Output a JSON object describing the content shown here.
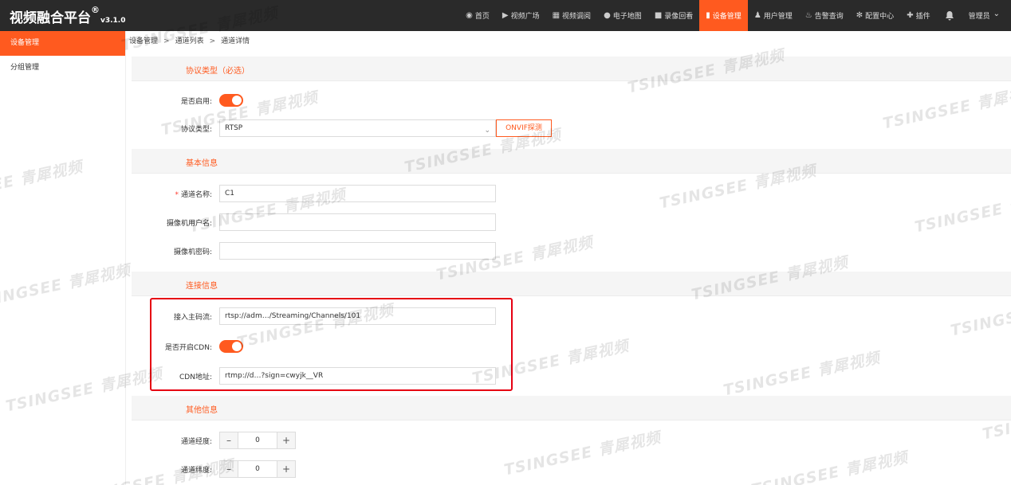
{
  "brand": {
    "title": "视频融合平台",
    "reg": "®",
    "version": "v3.1.0"
  },
  "nav": [
    {
      "label": "首页",
      "icon": "dashboard-icon",
      "glyph": "◉"
    },
    {
      "label": "视频广场",
      "icon": "play-circle-icon",
      "glyph": "▶"
    },
    {
      "label": "视频调阅",
      "icon": "grid-icon",
      "glyph": "▦"
    },
    {
      "label": "电子地图",
      "icon": "map-pin-icon",
      "glyph": "●"
    },
    {
      "label": "录像回看",
      "icon": "video-camera-icon",
      "glyph": "■"
    },
    {
      "label": "设备管理",
      "icon": "device-icon",
      "glyph": "▮"
    },
    {
      "label": "用户管理",
      "icon": "user-icon",
      "glyph": "♟"
    },
    {
      "label": "告警查询",
      "icon": "alarm-icon",
      "glyph": "♨"
    },
    {
      "label": "配置中心",
      "icon": "gear-icon",
      "glyph": "✻"
    },
    {
      "label": "插件",
      "icon": "puzzle-icon",
      "glyph": "✚"
    }
  ],
  "user": {
    "label": "管理员",
    "caret": "⌄",
    "bell": "🔔"
  },
  "sidebar": {
    "items": [
      {
        "label": "设备管理"
      },
      {
        "label": "分组管理"
      }
    ]
  },
  "breadcrumb": {
    "items": [
      "设备管理",
      "通道列表",
      "通道详情"
    ],
    "sep": ">"
  },
  "sections": {
    "protocol": {
      "title": "协议类型（必选）",
      "enable_label": "是否启用:",
      "type_label": "协议类型:",
      "type_value": "RTSP",
      "onvif_button": "ONVIF探测"
    },
    "basic": {
      "title": "基本信息",
      "name_label": "通道名称:",
      "name_value": "C1",
      "username_label": "摄像机用户名:",
      "username_value": "",
      "password_label": "摄像机密码:",
      "password_value": ""
    },
    "connection": {
      "title": "连接信息",
      "stream_label": "接入主码流:",
      "stream_value": "rtsp://adm…/Streaming/Channels/101",
      "cdn_enable_label": "是否开启CDN:",
      "cdn_url_label": "CDN地址:",
      "cdn_url_value": "rtmp://d…?sign=cwyjk__VR"
    },
    "other": {
      "title": "其他信息",
      "lng_label": "通道经度:",
      "lng_value": "0",
      "lat_label": "通道纬度:",
      "lat_value": "0",
      "minus": "–",
      "plus": "+"
    }
  },
  "watermark": "TSINGSEE 青犀视频",
  "colors": {
    "accent": "#ff5a1f",
    "topbar": "#2a2a2a",
    "highlight": "#e60012"
  }
}
